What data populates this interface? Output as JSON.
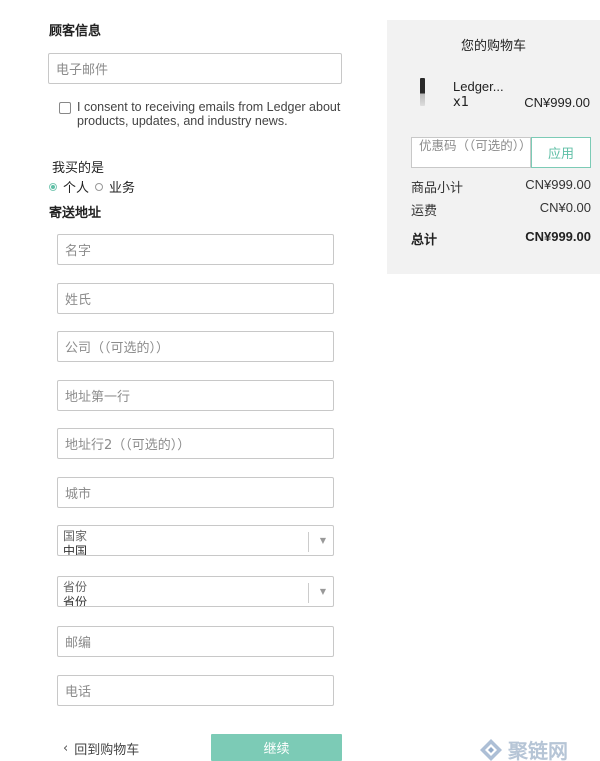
{
  "customer": {
    "section_title": "顾客信息",
    "email_placeholder": "电子邮件",
    "consent_text": "I consent to receiving emails from Ledger about products, updates, and industry news."
  },
  "buyer": {
    "label": "我买的是",
    "option_personal": "个人",
    "option_business": "业务"
  },
  "shipping": {
    "section_title": "寄送地址",
    "first_name": "名字",
    "last_name": "姓氏",
    "company": "公司（（可选的））",
    "address1": "地址第一行",
    "address2": "地址行2（（可选的））",
    "city": "城市",
    "country_label": "国家",
    "country_value": "中国",
    "province_label": "省份",
    "province_value": "省份",
    "postcode": "邮编",
    "phone": "电话"
  },
  "actions": {
    "back": "回到购物车",
    "continue": "继续"
  },
  "cart": {
    "title": "您的购物车",
    "product_name": "Ledger...",
    "product_qty": "x1",
    "product_price": "CN¥999.00",
    "coupon_placeholder": "优惠码（（可选的））",
    "apply": "应用",
    "subtotal_label": "商品小计",
    "subtotal_value": "CN¥999.00",
    "shipping_label": "运费",
    "shipping_value": "CN¥0.00",
    "total_label": "总计",
    "total_value": "CN¥999.00"
  },
  "watermark": {
    "text": "聚链网"
  },
  "colors": {
    "accent": "#7ccbb6",
    "accent_text": "#5fbfa6",
    "cart_bg": "#f2f2f2",
    "border": "#c8c8c8"
  }
}
